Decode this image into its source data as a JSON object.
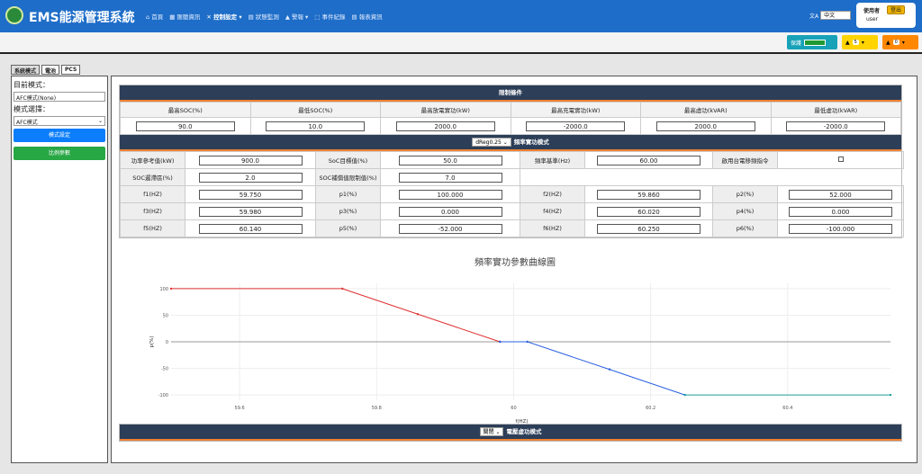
{
  "header": {
    "brand": "EMS能源管理系統",
    "nav": [
      "⌂ 首頁",
      "▦ 匯聽資訊",
      "✕ 控制設定 ▾",
      "▤ 狀態監測",
      "▲ 警報 ▾",
      "⬚ 事件紀錄",
      "▤ 報表資訊"
    ],
    "lang_icon": "文A",
    "lang": "中文",
    "user_label": "使用者",
    "logout": "登出",
    "username": "user"
  },
  "status": {
    "protect_label": "保護",
    "warn_count": "5",
    "alarm_count": "0"
  },
  "tabs": [
    "系統模式",
    "電池",
    "PCS"
  ],
  "left": {
    "current_mode_label": "目前模式：",
    "current_mode_value": "AFC模式(None)",
    "mode_select_label": "模式選擇：",
    "mode_select_value": "AFC模式",
    "mode_set_button": "模式設定",
    "ratio_button": "比例參數"
  },
  "limits": {
    "title": "限制條件",
    "headers": [
      "最高SOC(%)",
      "最低SOC(%)",
      "最高放電實功(kW)",
      "最高充電實功(kW)",
      "最高虛功(kVAR)",
      "最低虛功(kVAR)"
    ],
    "values": [
      "90.0",
      "10.0",
      "2000.0",
      "-2000.0",
      "2000.0",
      "-2000.0"
    ]
  },
  "freq": {
    "select_value": "dReg0.25",
    "title": "頻率實功模式",
    "row1": {
      "power_ref_label": "功率參考值(kW)",
      "power_ref": "900.0",
      "soc_target_label": "SoC目標值(%)",
      "soc_target": "50.0",
      "freq_base_label": "頻率基準(Hz)",
      "freq_base": "60.00",
      "shift_label": "啟用台電移頻指令"
    },
    "row2": {
      "soc_band_label": "SOC遲滯區(%)",
      "soc_band": "2.0",
      "soc_comp_label": "SOC補償值限制值(%)",
      "soc_comp": "7.0"
    },
    "points": [
      {
        "fl": "f1(HZ)",
        "fv": "59.750",
        "pl": "p1(%)",
        "pv": "100.000",
        "fl2": "f2(HZ)",
        "fv2": "59.860",
        "pl2": "p2(%)",
        "pv2": "52.000"
      },
      {
        "fl": "f3(HZ)",
        "fv": "59.980",
        "pl": "p3(%)",
        "pv": "0.000",
        "fl2": "f4(HZ)",
        "fv2": "60.020",
        "pl2": "p4(%)",
        "pv2": "0.000"
      },
      {
        "fl": "f5(HZ)",
        "fv": "60.140",
        "pl": "p5(%)",
        "pv": "-52.000",
        "fl2": "f6(HZ)",
        "fv2": "60.250",
        "pl2": "p6(%)",
        "pv2": "-100.000"
      }
    ]
  },
  "voltage": {
    "select_value": "關閉",
    "title": "電壓虛功模式"
  },
  "chart_data": {
    "type": "line",
    "title": "頻率實功參數曲線圖",
    "xlabel": "f(HZ)",
    "ylabel": "p(%)",
    "xlim": [
      59.5,
      60.55
    ],
    "ylim": [
      -110,
      110
    ],
    "xticks": [
      59.6,
      59.8,
      60,
      60.2,
      60.4
    ],
    "yticks": [
      100,
      50,
      0,
      -50,
      -100
    ],
    "grid": true,
    "series": [
      {
        "color": "#e03030",
        "points": [
          [
            59.5,
            100
          ],
          [
            59.75,
            100
          ],
          [
            59.86,
            52
          ],
          [
            59.98,
            0
          ]
        ]
      },
      {
        "color": "#2a60e0",
        "points": [
          [
            59.98,
            0
          ],
          [
            60.02,
            0
          ],
          [
            60.14,
            -52
          ],
          [
            60.25,
            -100
          ]
        ]
      },
      {
        "color": "#20a0a0",
        "points": [
          [
            60.25,
            -100
          ],
          [
            60.55,
            -100
          ]
        ]
      }
    ]
  }
}
